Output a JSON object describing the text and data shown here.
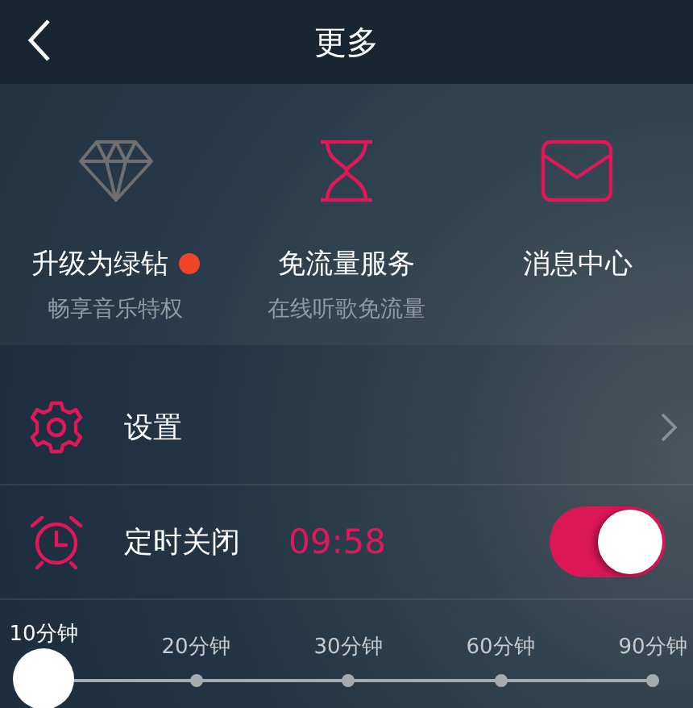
{
  "header": {
    "title": "更多"
  },
  "features": [
    {
      "kind": "diamond",
      "title": "升级为绿钻",
      "subtitle": "畅享音乐特权",
      "badge": true
    },
    {
      "kind": "hourglass",
      "title": "免流量服务",
      "subtitle": "在线听歌免流量",
      "badge": false
    },
    {
      "kind": "mail",
      "title": "消息中心",
      "badge": false
    }
  ],
  "settings_row": {
    "label": "设置"
  },
  "timer_row": {
    "label": "定时关闭",
    "countdown": "09:58",
    "on": true
  },
  "timer_options": [
    {
      "label": "10分钟",
      "selected": true
    },
    {
      "label": "20分钟",
      "selected": false
    },
    {
      "label": "30分钟",
      "selected": false
    },
    {
      "label": "60分钟",
      "selected": false
    },
    {
      "label": "90分钟",
      "selected": false
    }
  ]
}
